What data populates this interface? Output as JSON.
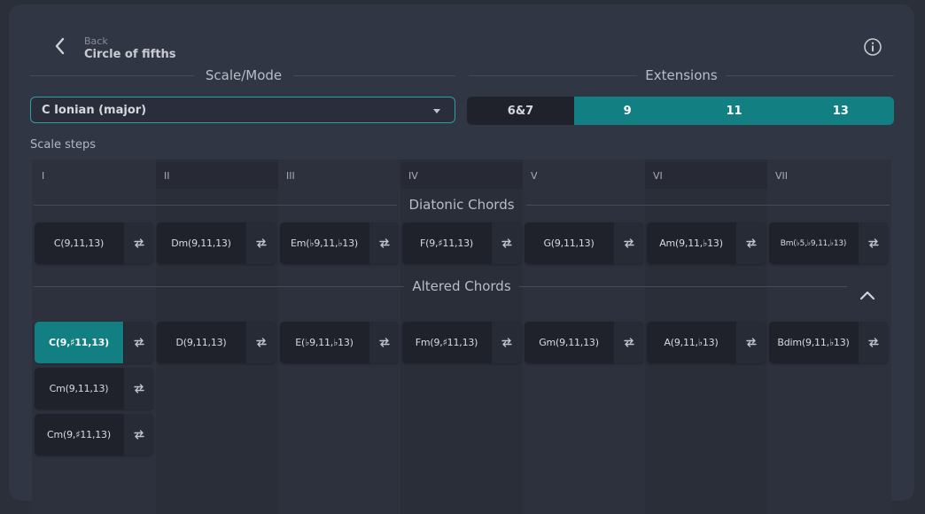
{
  "header": {
    "back_label": "Back",
    "title": "Circle of fifths"
  },
  "scale_mode": {
    "title": "Scale/Mode",
    "value": "C Ionian (major)"
  },
  "extensions": {
    "title": "Extensions",
    "options": [
      {
        "label": "6&7",
        "active": false
      },
      {
        "label": "9",
        "active": true
      },
      {
        "label": "11",
        "active": true
      },
      {
        "label": "13",
        "active": true
      }
    ],
    "accent_color": "#128083"
  },
  "scale_steps": {
    "label": "Scale steps",
    "steps": [
      "I",
      "II",
      "III",
      "IV",
      "V",
      "VI",
      "VII"
    ]
  },
  "diatonic": {
    "title": "Diatonic Chords",
    "chords": [
      "C(9,11,13)",
      "Dm(9,11,13)",
      "Em(♭9,11,♭13)",
      "F(9,♯11,13)",
      "G(9,11,13)",
      "Am(9,11,♭13)",
      "Bm(♭5,♭9,11,♭13)"
    ]
  },
  "altered": {
    "title": "Altered Chords",
    "row1": [
      "C(9,♯11,13)",
      "D(9,11,13)",
      "E(♭9,11,♭13)",
      "Fm(9,♯11,13)",
      "Gm(9,11,13)",
      "A(9,11,♭13)",
      "Bdim(9,11,♭13)"
    ],
    "col1_extra": [
      "Cm(9,11,13)",
      "Cm(9,♯11,13)"
    ],
    "active_chord": "C(9,♯11,13)"
  },
  "icons": {
    "back": "chevron-left-icon",
    "info": "info-icon",
    "swap": "swap-icon",
    "collapse": "chevron-up-icon"
  }
}
